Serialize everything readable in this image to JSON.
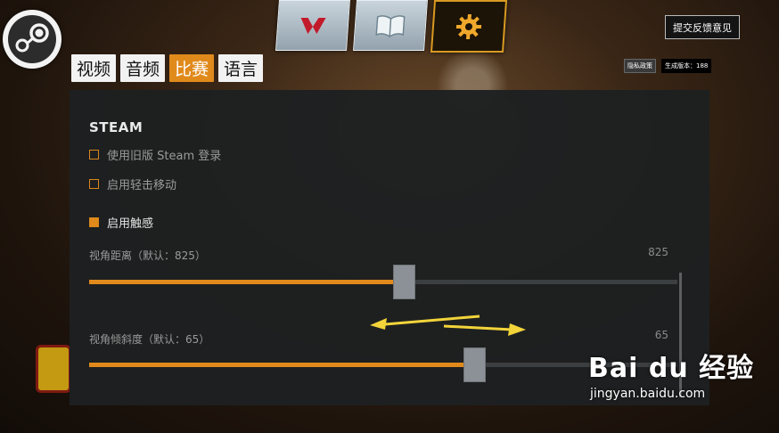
{
  "window": {
    "feedback_button": "提交反馈意见",
    "privacy_button": "隐私政策",
    "build_label": "生成版本：188"
  },
  "tabs": [
    {
      "label": "视频",
      "active": false
    },
    {
      "label": "音频",
      "active": false
    },
    {
      "label": "比赛",
      "active": true
    },
    {
      "label": "语言",
      "active": false
    }
  ],
  "hero_icons": [
    "hero-portrait-icon",
    "book-icon",
    "gear-icon"
  ],
  "section": {
    "title": "STEAM",
    "checkboxes": [
      {
        "label": "使用旧版 Steam 登录",
        "checked": false
      },
      {
        "label": "启用轻击移动",
        "checked": false
      },
      {
        "label": "启用触感",
        "checked": true
      }
    ]
  },
  "sliders": [
    {
      "label": "视角距离（默认：825）",
      "value": "825",
      "fraction": 0.52
    },
    {
      "label": "视角倾斜度（默认：65）",
      "value": "65",
      "fraction": 0.64
    }
  ],
  "watermark": {
    "logo": "Bai du 经验",
    "url": "jingyan.baidu.com"
  },
  "colors": {
    "accent": "#e08a1c",
    "panel": "#1e2021",
    "track": "#3c3f41",
    "thumb": "#8b9196",
    "annotation_arrow": "#f2d43a"
  }
}
